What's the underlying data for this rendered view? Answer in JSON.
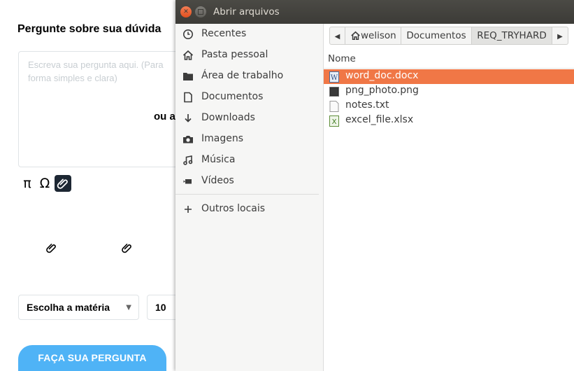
{
  "page": {
    "title": "Pergunte sobre sua dúvida",
    "question_placeholder": "Escreva sua pergunta aqui. (Para forma simples e clara)",
    "or_text": "ou a",
    "toolbar": {
      "pi": "π",
      "omega": "Ω"
    },
    "subject_select": "Escolha a matéria",
    "points_value": "10",
    "ask_button": "FAÇA SUA PERGUNTA"
  },
  "dialog": {
    "title": "Abrir arquivos",
    "sidebar": [
      {
        "label": "Recentes",
        "icon": "clock-icon"
      },
      {
        "label": "Pasta pessoal",
        "icon": "home-icon"
      },
      {
        "label": "Área de trabalho",
        "icon": "desktop-folder-icon"
      },
      {
        "label": "Documentos",
        "icon": "document-icon"
      },
      {
        "label": "Downloads",
        "icon": "download-icon"
      },
      {
        "label": "Imagens",
        "icon": "camera-icon"
      },
      {
        "label": "Música",
        "icon": "music-icon"
      },
      {
        "label": "Vídeos",
        "icon": "video-icon"
      },
      {
        "label": "Outros locais",
        "icon": "plus-icon"
      }
    ],
    "path": [
      "welison",
      "Documentos",
      "REQ_TRYHARD"
    ],
    "column_header": "Nome",
    "files": [
      {
        "name": "word_doc.docx",
        "icon": "word-doc-icon",
        "selected": true
      },
      {
        "name": "png_photo.png",
        "icon": "image-file-icon",
        "selected": false
      },
      {
        "name": "notes.txt",
        "icon": "text-file-icon",
        "selected": false
      },
      {
        "name": "excel_file.xlsx",
        "icon": "spreadsheet-icon",
        "selected": false
      }
    ]
  },
  "colors": {
    "selection": "#f07746",
    "titlebar": "#3c3b37",
    "close_button": "#e95420",
    "ask_button": "#4fb3f6"
  }
}
